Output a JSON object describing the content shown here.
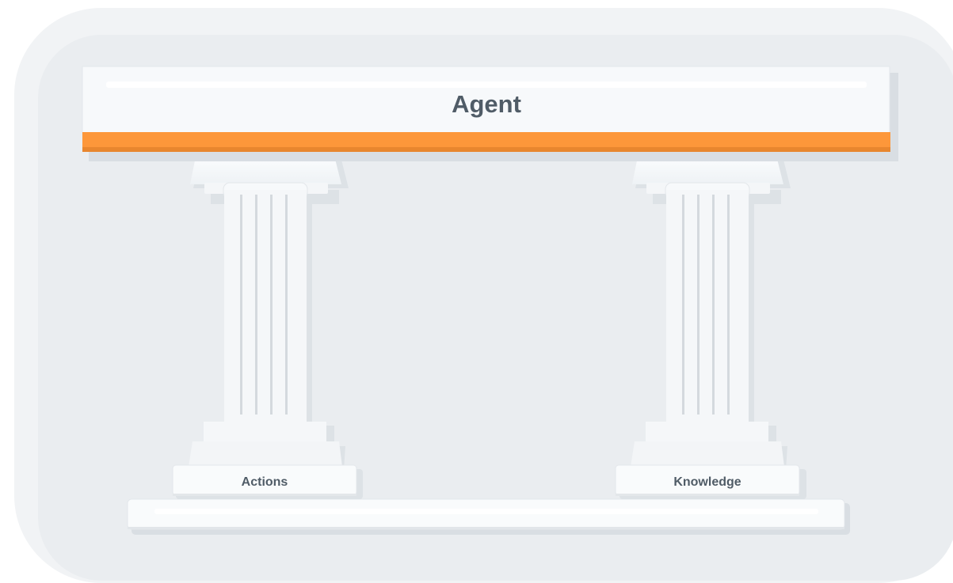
{
  "diagram": {
    "roof_label": "Agent",
    "pillars": [
      {
        "label": "Actions"
      },
      {
        "label": "Knowledge"
      }
    ],
    "colors": {
      "accent": "#fd973a",
      "background_panel": "#eaedf0",
      "marble": "#f7f9fb",
      "text": "#505c67"
    }
  }
}
